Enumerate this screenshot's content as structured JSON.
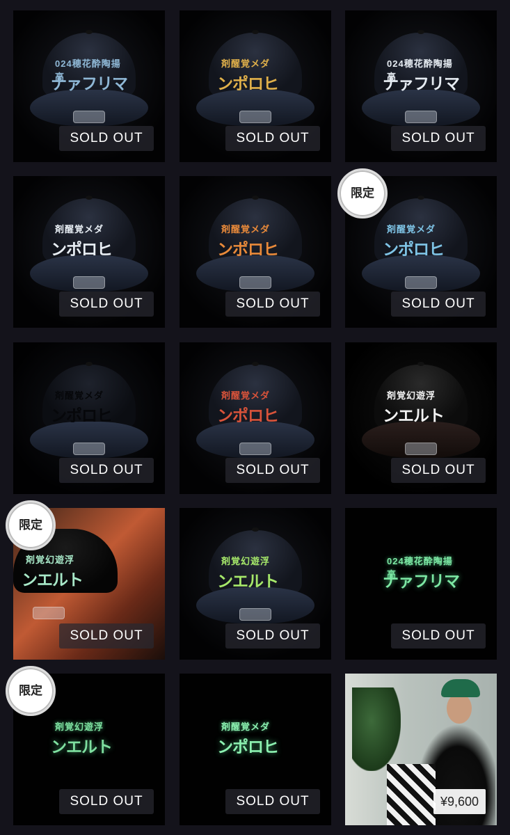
{
  "products": [
    {
      "status": "SOLD OUT",
      "badge": "",
      "emb_line1": "024穂花酔陶揚高",
      "emb_line2": "ナァフリマ",
      "emb_color": "#8fb8d6",
      "cap_color": "#1c2232"
    },
    {
      "status": "SOLD OUT",
      "badge": "",
      "emb_line1": "剤醒覚メダ",
      "emb_line2": "ンポロヒ",
      "emb_color": "#e0b04a",
      "cap_color": "#1a1f2b"
    },
    {
      "status": "SOLD OUT",
      "badge": "",
      "emb_line1": "024穂花酔陶揚高",
      "emb_line2": "ナァフリマ",
      "emb_color": "#e6ecf2",
      "cap_color": "#1c2232"
    },
    {
      "status": "SOLD OUT",
      "badge": "",
      "emb_line1": "剤醒覚メダ",
      "emb_line2": "ンポロヒ",
      "emb_color": "#e8eef4",
      "cap_color": "#1c2232"
    },
    {
      "status": "SOLD OUT",
      "badge": "",
      "emb_line1": "剤醒覚メダ",
      "emb_line2": "ンポロヒ",
      "emb_color": "#e98a3a",
      "cap_color": "#1c2232"
    },
    {
      "status": "SOLD OUT",
      "badge": "限定",
      "emb_line1": "剤醒覚メダ",
      "emb_line2": "ンポロヒ",
      "emb_color": "#7fc4e6",
      "cap_color": "#1c2232"
    },
    {
      "status": "SOLD OUT",
      "badge": "",
      "emb_line1": "剤醒覚メダ",
      "emb_line2": "ンポロヒ",
      "emb_color": "#0c0f15",
      "cap_color": "#1a1f2b"
    },
    {
      "status": "SOLD OUT",
      "badge": "",
      "emb_line1": "剤醒覚メダ",
      "emb_line2": "ンポロヒ",
      "emb_color": "#d9533a",
      "cap_color": "#1c2232"
    },
    {
      "status": "SOLD OUT",
      "badge": "",
      "emb_line1": "剤覚幻遊浮",
      "emb_line2": "ンエルト",
      "emb_color": "#f2f2f2",
      "cap_color": "#101010"
    },
    {
      "status": "SOLD OUT",
      "badge": "限定",
      "emb_line1": "剤覚幻遊浮",
      "emb_line2": "ンエルト",
      "emb_color": "#a8e8c8",
      "cap_color": "#0c0c0c"
    },
    {
      "status": "SOLD OUT",
      "badge": "",
      "emb_line1": "剤覚幻遊浮",
      "emb_line2": "ンエルト",
      "emb_color": "#a6e86a",
      "cap_color": "#1c2232"
    },
    {
      "status": "SOLD OUT",
      "badge": "",
      "emb_line1": "024穂花酔陶揚高",
      "emb_line2": "ナァフリマ",
      "emb_color": "#7de8a4",
      "cap_color": "#020202"
    },
    {
      "status": "SOLD OUT",
      "badge": "限定",
      "emb_line1": "剤覚幻遊浮",
      "emb_line2": "ンエルト",
      "emb_color": "#7fe0a0",
      "cap_color": "#020202"
    },
    {
      "status": "SOLD OUT",
      "badge": "",
      "emb_line1": "剤醒覚メダ",
      "emb_line2": "ンポロヒ",
      "emb_color": "#8cf0b0",
      "cap_color": "#020202"
    },
    {
      "status": "",
      "badge": "",
      "price": "¥9,600",
      "emb_line1": "",
      "emb_line2": "",
      "emb_color": "#ffffff",
      "cap_color": "#1f6b4a"
    }
  ],
  "colors": {
    "page_bg": "#14131b",
    "tile_bg": "#07070a",
    "sold_bg": "#28283080"
  }
}
